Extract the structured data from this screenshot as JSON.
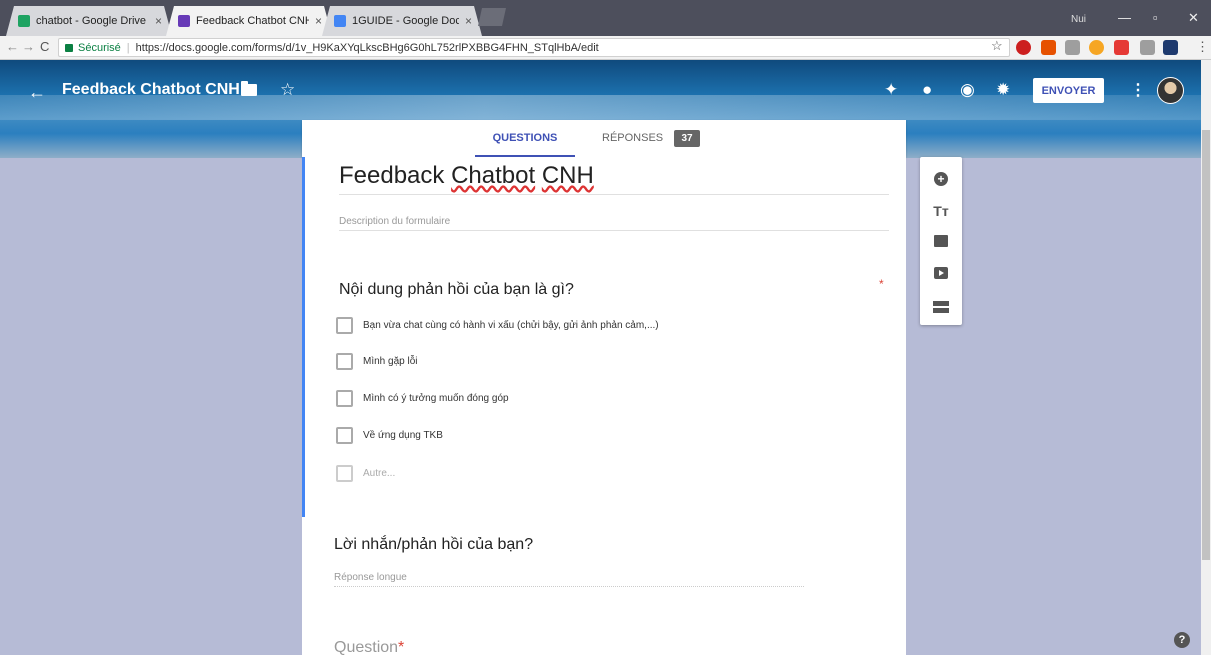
{
  "browser": {
    "tabs": [
      {
        "title": "chatbot - Google Drive",
        "close": "×",
        "color": "#1ea362"
      },
      {
        "title": "Feedback Chatbot CNH",
        "close": "×",
        "color": "#673ab7"
      },
      {
        "title": "1GUIDE - Google Docs",
        "close": "×",
        "color": "#4285f4"
      }
    ],
    "user_name": "Nui",
    "address": {
      "secure_label": "Sécurisé",
      "separator": "|",
      "url": "https://docs.google.com/forms/d/1v_H9KaXYqLkscBHg6G0hL752rlPXBBG4FHN_STqlHbA/edit"
    },
    "extension_colors": [
      "#cc1f1f",
      "#e65100",
      "#9e9e9e",
      "#f6a623",
      "#e53935",
      "#9e9e9e",
      "#1e3a6e"
    ]
  },
  "header": {
    "form_title": "Feedback Chatbot CNH",
    "send_label": "ENVOYER",
    "back_icon": "←",
    "star_icon": "☆",
    "more_icon": "⋮"
  },
  "tabs": {
    "questions": "QUESTIONS",
    "responses": "RÉPONSES",
    "response_count": "37"
  },
  "form": {
    "title_part1": "Feedback ",
    "title_part2": "Chatbot",
    "title_space": " ",
    "title_part3": "CNH",
    "description_placeholder": "Description du formulaire",
    "question1": {
      "title": "Nội dung phản hồi của bạn là gì?",
      "required_mark": "*",
      "options": [
        "Bạn vừa chat cùng có hành vi xấu (chửi bậy, gửi ảnh phản cảm,...)",
        "Mình gặp lỗi",
        "Mình có ý tưởng muốn đóng góp",
        "Về ứng dụng TKB"
      ],
      "other_label": "Autre..."
    },
    "question2": {
      "title": "Lời nhắn/phản hồi của bạn?",
      "hint": "Réponse longue"
    },
    "question3": {
      "title": "Question",
      "required_mark": "*"
    }
  },
  "help_label": "?"
}
